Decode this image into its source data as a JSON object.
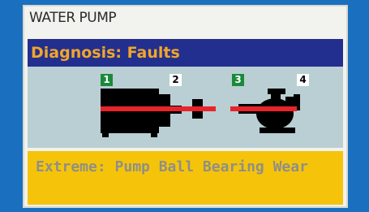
{
  "panel": {
    "title": "WATER PUMP",
    "diagnosis_label": "Diagnosis: Faults",
    "alert_text": "Extreme: Pump Ball Bearing Wear"
  },
  "diagram": {
    "tags": [
      {
        "label": "1",
        "style": "green"
      },
      {
        "label": "2",
        "style": "white"
      },
      {
        "label": "3",
        "style": "green"
      },
      {
        "label": "4",
        "style": "white"
      }
    ],
    "icons": [
      "motor-icon",
      "coupling-icon",
      "pump-icon"
    ]
  },
  "colors": {
    "background": "#1a6fbf",
    "diagnosis_bar": "#232f8e",
    "diagnosis_text": "#f0a62a",
    "diagram_bg": "#b9cfd3",
    "alert_bg": "#f5c40a",
    "alert_text": "#8f8f87",
    "fault_line": "#e8242b"
  }
}
